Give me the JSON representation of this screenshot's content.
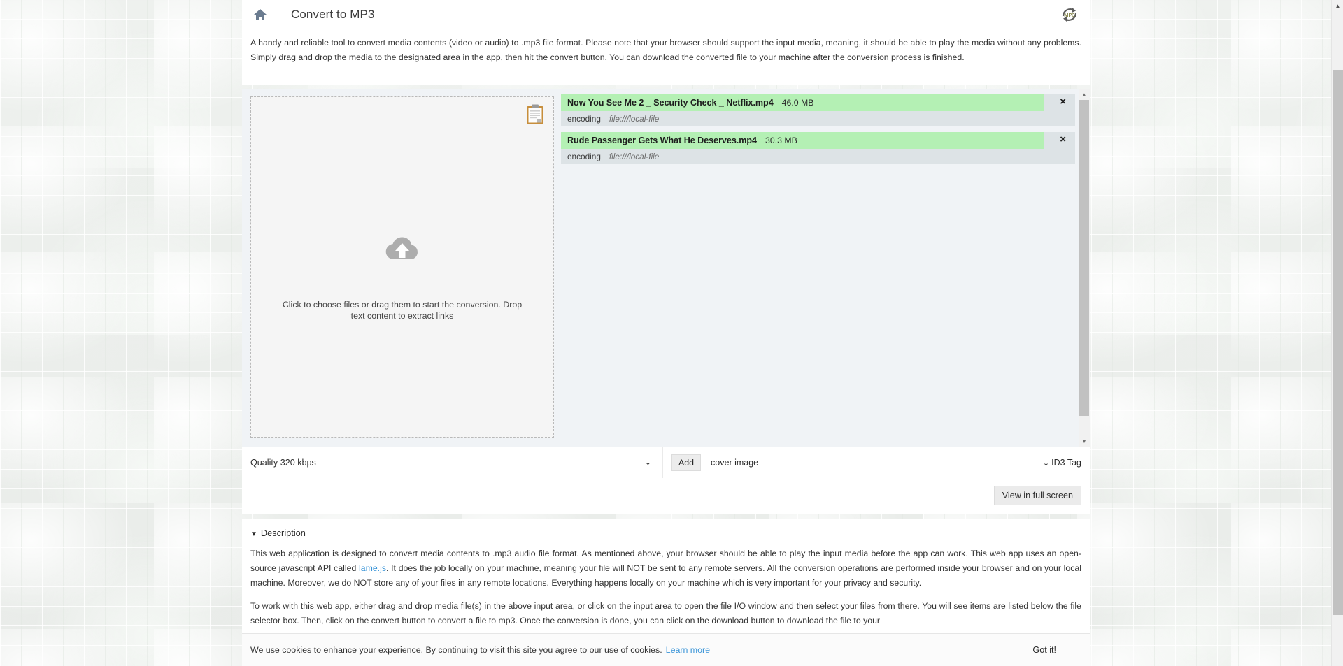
{
  "header": {
    "home_icon": "home-icon",
    "title": "Convert to MP3",
    "logo_text": "MP3",
    "logo_icon": "recycle-arrows-icon"
  },
  "intro": "A handy and reliable tool to convert media contents (video or audio) to .mp3 file format. Please note that your browser should support the input media, meaning, it should be able to play the media without any problems. Simply drag and drop the media to the designated area in the app, then hit the convert button. You can download the converted file to your machine after the conversion process is finished.",
  "dropzone": {
    "clipboard_icon": "clipboard-icon",
    "cloud_icon": "cloud-upload-icon",
    "text": "Click to choose files or drag them to start the conversion. Drop text content to extract links"
  },
  "files": [
    {
      "name": "Now You See Me 2 _ Security Check _ Netflix.mp4",
      "size": "46.0 MB",
      "status_label": "encoding",
      "status_value": "file:///local-file",
      "close_icon": "×"
    },
    {
      "name": "Rude Passenger Gets What He Deserves.mp4",
      "size": "30.3 MB",
      "status_label": "encoding",
      "status_value": "file:///local-file",
      "close_icon": "×"
    }
  ],
  "options": {
    "quality": "Quality 320 kbps",
    "quality_caret": "⌄",
    "add_label": "Add",
    "cover_label": "cover image",
    "id3_label": "ID3 Tag",
    "id3_caret": "⌄"
  },
  "fullscreen_button": "View in full screen",
  "description": {
    "heading_caret": "▼",
    "heading": "Description",
    "paragraph1_before": "This web application is designed to convert media contents to .mp3 audio file format. As mentioned above, your browser should be able to play the input media before the app can work. This web app uses an open-source javascript API called ",
    "paragraph1_link": "lame.js",
    "paragraph1_after": ". It does the job locally on your machine, meaning your file will NOT be sent to any remote servers. All the conversion operations are performed inside your browser and on your local machine. Moreover, we do NOT store any of your files in any remote locations. Everything happens locally on your machine which is very important for your privacy and security.",
    "paragraph2": "To work with this web app, either drag and drop media file(s) in the above input area, or click on the input area to open the file I/O window and then select your files from there. You will see items are listed below the file selector box. Then, click on the convert button to convert a file to mp3. Once the conversion is done, you can click on the download button to download the file to your"
  },
  "cookie_bar": {
    "text": "We use cookies to enhance your experience. By continuing to visit this site you agree to our use of cookies.",
    "link": "Learn more",
    "accept_label": "Got it!"
  },
  "scrollbars": {
    "up_arrow": "▲",
    "down_arrow": "▼"
  },
  "colors": {
    "file_highlight": "#b4f0b4",
    "link": "#3a95d8",
    "panel_bg": "#f0f3f6"
  }
}
